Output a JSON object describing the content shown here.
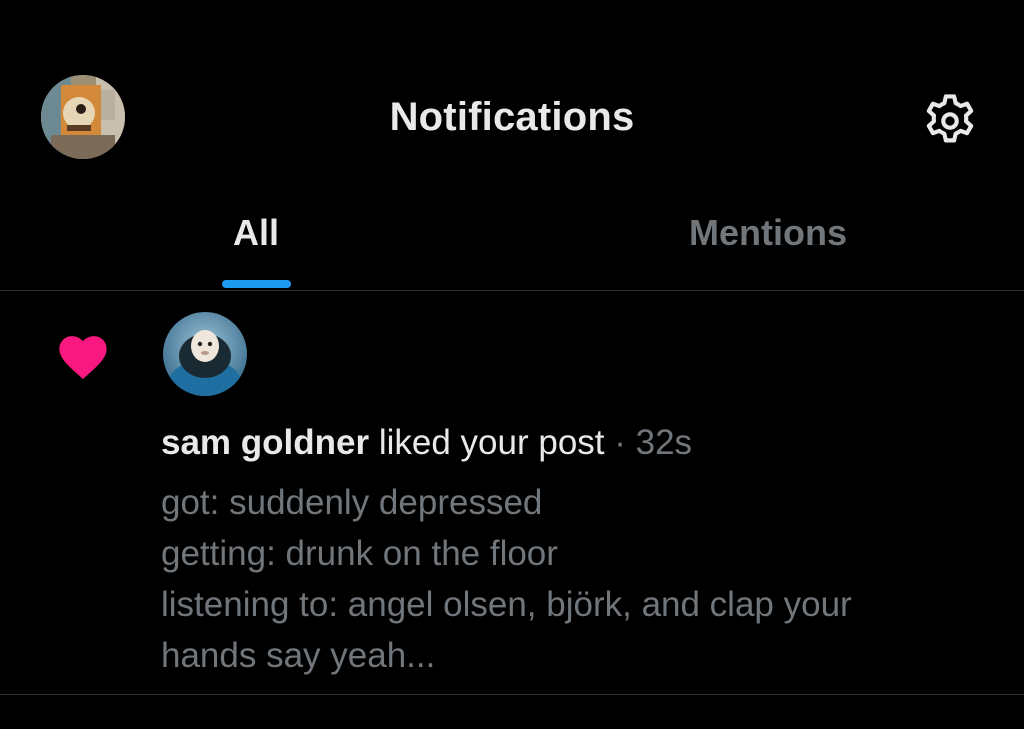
{
  "header": {
    "title": "Notifications",
    "profile_avatar": "user-avatar",
    "settings_icon": "gear-icon"
  },
  "tabs": [
    {
      "label": "All",
      "active": true
    },
    {
      "label": "Mentions",
      "active": false
    }
  ],
  "colors": {
    "background": "#000000",
    "accent": "#1d9bf0",
    "like": "#f91880",
    "primary_text": "#e7e9ea",
    "secondary_text": "#71767b",
    "divider": "#2f3336"
  },
  "notification": {
    "icon": "heart-icon",
    "user_name": "sam goldner",
    "action": " liked your post",
    "separator": " · ",
    "time": "32s",
    "post_lines": [
      "got: suddenly depressed",
      "getting: drunk on the floor",
      "listening to: angel olsen, björk, and clap your",
      "hands say yeah..."
    ]
  }
}
